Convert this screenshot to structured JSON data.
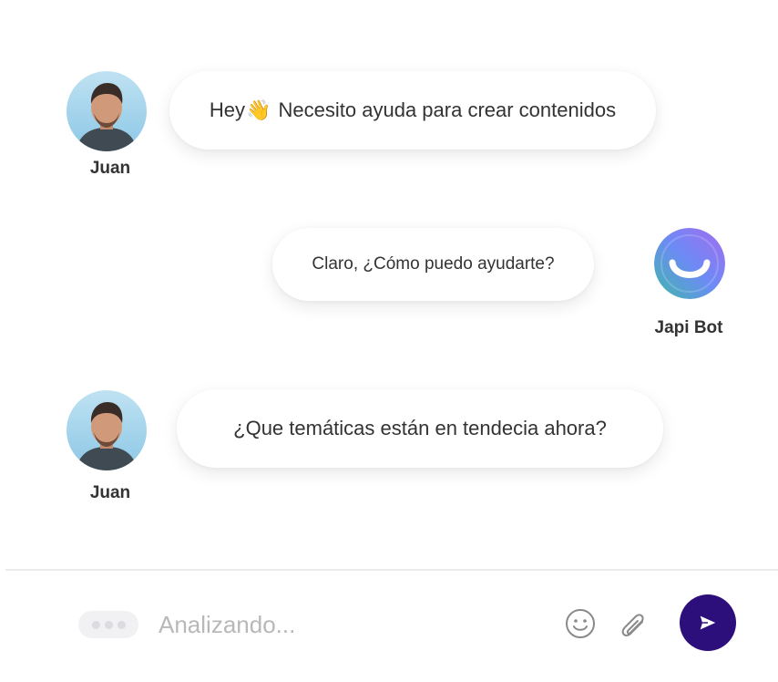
{
  "messages": [
    {
      "sender": "Juan",
      "text_before": "Hey",
      "emoji": "👋",
      "text_after": " Necesito ayuda para crear contenidos"
    },
    {
      "sender": "Japi Bot",
      "text": "Claro, ¿Cómo puedo ayudarte?"
    },
    {
      "sender": "Juan",
      "text": "¿Que temáticas están en tendecia ahora?"
    }
  ],
  "composer": {
    "placeholder": "Analizando...",
    "icons": [
      "emoji-icon",
      "paperclip-icon",
      "send-icon"
    ]
  },
  "colors": {
    "send_button": "#2c0f7a",
    "bot_gradient": [
      "#3fb8a9",
      "#6c8bf5",
      "#a46cf0"
    ],
    "text": "#333333",
    "placeholder": "#b8b8b8"
  }
}
